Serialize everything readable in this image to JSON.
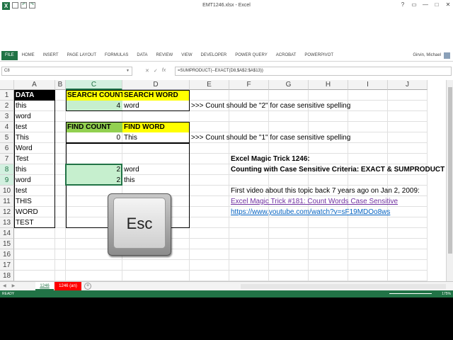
{
  "window": {
    "title": "EMT1246.xlsx - Excel",
    "controls": [
      "?",
      "▭",
      "—",
      "□",
      "✕"
    ]
  },
  "ribbon": {
    "file_tab": "FILE",
    "tabs": [
      "HOME",
      "INSERT",
      "PAGE LAYOUT",
      "FORMULAS",
      "DATA",
      "REVIEW",
      "VIEW",
      "DEVELOPER",
      "POWER QUERY",
      "ACROBAT",
      "POWERPIVOT"
    ],
    "user_name": "Girvin, Michael"
  },
  "formula_bar": {
    "name_box": "C8",
    "cancel": "✕",
    "enter": "✓",
    "fx": "fx",
    "formula": "=SUMPRODUCT(--EXACT(D8,$A$2:$A$13))"
  },
  "columns": [
    "A",
    "B",
    "C",
    "D",
    "E",
    "F",
    "G",
    "H",
    "I",
    "J"
  ],
  "rows": [
    "1",
    "2",
    "3",
    "4",
    "5",
    "6",
    "7",
    "8",
    "9",
    "10",
    "11",
    "12",
    "13",
    "14",
    "15",
    "16",
    "17",
    "18"
  ],
  "cells": {
    "A1": "DATA",
    "A2": "this",
    "A3": "word",
    "A4": "test",
    "A5": "This",
    "A6": "Word",
    "A7": "Test",
    "A8": "this",
    "A9": "word",
    "A10": "test",
    "A11": "THIS",
    "A12": "WORD",
    "A13": "TEST",
    "C1": "SEARCH COUNT",
    "D1": "SEARCH WORD",
    "C2": "4",
    "D2": "word",
    "C4": "FIND COUNT",
    "D4": "FIND WORD",
    "C5": "0",
    "D5": "This",
    "C8": "2",
    "D8": "word",
    "C9": "2",
    "D9": "this",
    "E2": ">>> Count should be \"2\" for case sensitive spelling",
    "E5": ">>> Count should be \"1\" for case sensitive spelling",
    "F7": "Excel Magic Trick 1246:",
    "F8": "Counting with Case Sensitive Criteria: EXACT & SUMPRODUCT",
    "F10": "First video about this topic back 7 years ago on Jan 2, 2009:",
    "F11": "Excel Magic Trick #181: Count Words Case Sensitive",
    "F12": "https://www.youtube.com/watch?v=sF19MDOo8ws"
  },
  "overlay": {
    "esc_key_label": "Esc"
  },
  "sheets": {
    "active": "1246",
    "other": "1246 (an)",
    "add": "+"
  },
  "status": {
    "mode": "READY",
    "zoom": "175%"
  }
}
